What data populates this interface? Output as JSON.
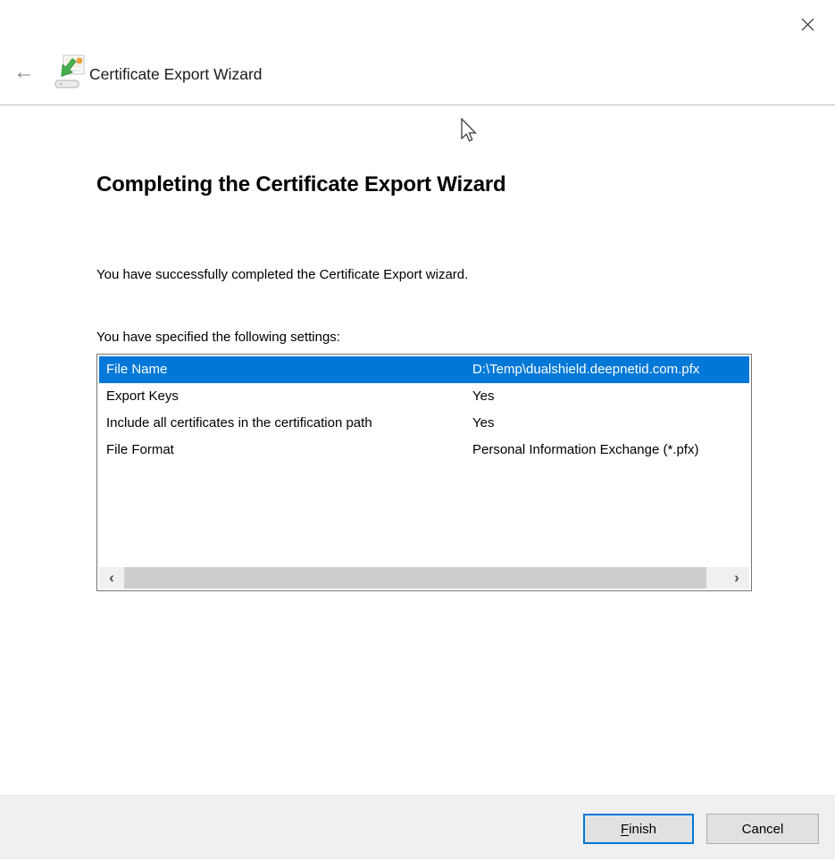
{
  "window": {
    "title": "Certificate Export Wizard"
  },
  "header": {
    "title": "Certificate Export Wizard"
  },
  "icons": {
    "close": "window-close-icon",
    "back": "←",
    "wizard": "certificate-export-icon",
    "cursor": "mouse-pointer-icon",
    "scroll_left": "‹",
    "scroll_right": "›"
  },
  "main": {
    "heading": "Completing the Certificate Export Wizard",
    "intro": "You have successfully completed the Certificate Export wizard.",
    "settings_label": "You have specified the following settings:",
    "settings": [
      {
        "name": "File Name",
        "value": "D:\\Temp\\dualshield.deepnetid.com.pfx",
        "selected": true
      },
      {
        "name": "Export Keys",
        "value": "Yes",
        "selected": false
      },
      {
        "name": "Include all certificates in the certification path",
        "value": "Yes",
        "selected": false
      },
      {
        "name": "File Format",
        "value": "Personal Information Exchange (*.pfx)",
        "selected": false
      }
    ]
  },
  "footer": {
    "finish_accel": "F",
    "finish_rest": "inish",
    "cancel_label": "Cancel"
  },
  "colors": {
    "selection_bg": "#0078d7",
    "selection_text": "#ffffff",
    "focus_border": "#0078d7",
    "button_bg": "#e1e1e1",
    "button_border": "#adadad",
    "footer_bg": "#f0f0f0",
    "scroll_track": "#f0f0f0",
    "scroll_thumb": "#cdcdcd",
    "listbox_border": "#767676",
    "divider": "#bfbfbf"
  }
}
